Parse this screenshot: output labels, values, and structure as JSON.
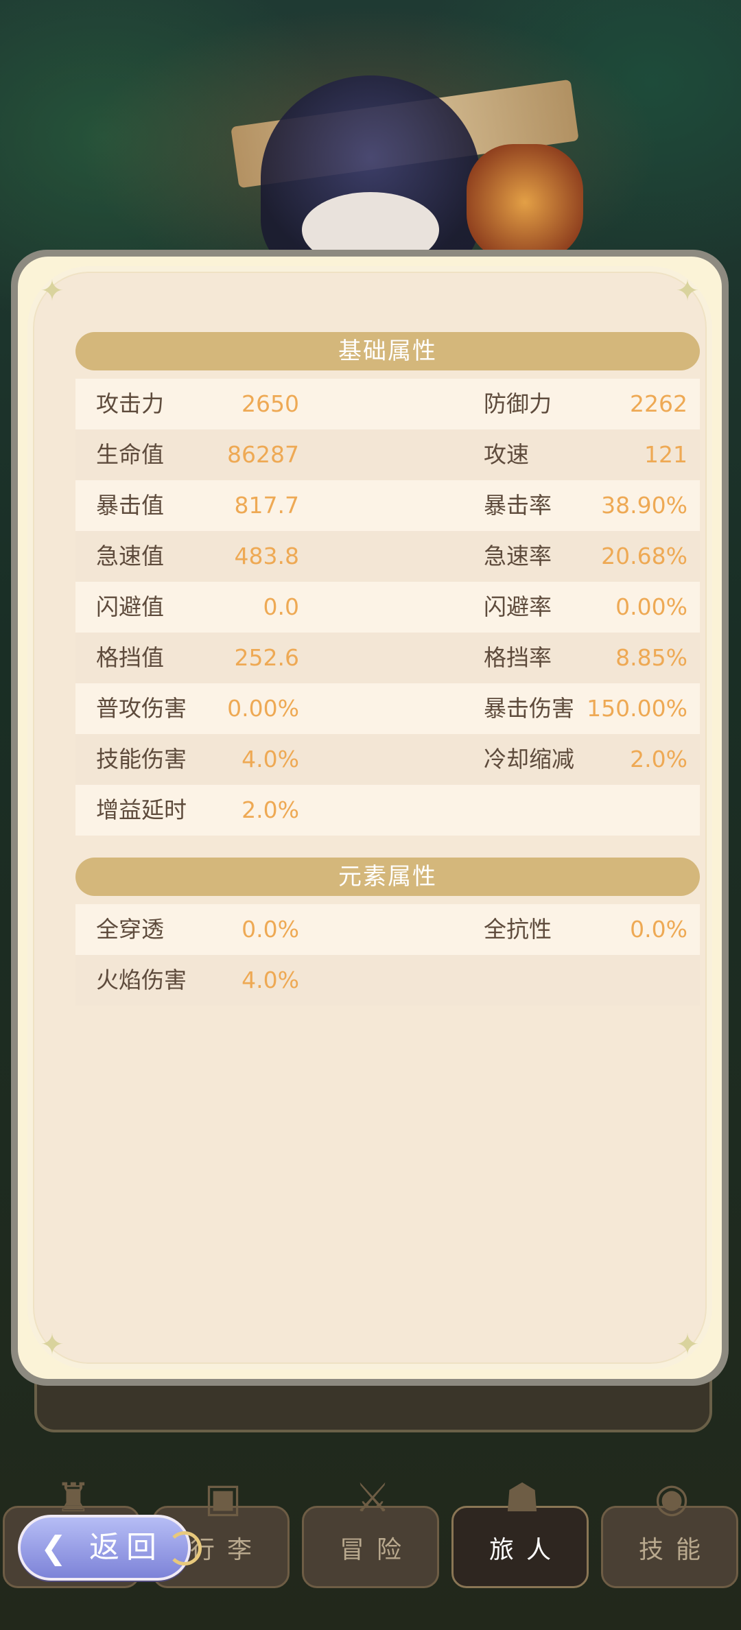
{
  "base_section": {
    "title": "基础属性",
    "rows": [
      {
        "left_label": "攻击力",
        "left_value": "2650",
        "right_label": "防御力",
        "right_value": "2262"
      },
      {
        "left_label": "生命值",
        "left_value": "86287",
        "right_label": "攻速",
        "right_value": "121"
      },
      {
        "left_label": "暴击值",
        "left_value": "817.7",
        "right_label": "暴击率",
        "right_value": "38.90%"
      },
      {
        "left_label": "急速值",
        "left_value": "483.8",
        "right_label": "急速率",
        "right_value": "20.68%"
      },
      {
        "left_label": "闪避值",
        "left_value": "0.0",
        "right_label": "闪避率",
        "right_value": "0.00%"
      },
      {
        "left_label": "格挡值",
        "left_value": "252.6",
        "right_label": "格挡率",
        "right_value": "8.85%"
      },
      {
        "left_label": "普攻伤害",
        "left_value": "0.00%",
        "right_label": "暴击伤害",
        "right_value": "150.00%"
      },
      {
        "left_label": "技能伤害",
        "left_value": "4.0%",
        "right_label": "冷却缩减",
        "right_value": "2.0%"
      },
      {
        "left_label": "增益延时",
        "left_value": "2.0%",
        "right_label": "",
        "right_value": ""
      }
    ]
  },
  "element_section": {
    "title": "元素属性",
    "rows": [
      {
        "left_label": "全穿透",
        "left_value": "0.0%",
        "right_label": "全抗性",
        "right_value": "0.0%"
      },
      {
        "left_label": "火焰伤害",
        "left_value": "4.0%",
        "right_label": "",
        "right_value": ""
      }
    ]
  },
  "nav": {
    "tabs": [
      {
        "label": "行李",
        "icon": "chest-icon"
      },
      {
        "label": "冒险",
        "icon": "crossed-swords-icon"
      },
      {
        "label": "旅人",
        "icon": "hooded-figure-icon"
      },
      {
        "label": "技能",
        "icon": "eye-emblem-icon"
      }
    ],
    "back_label": "返回"
  },
  "colors": {
    "header_bg": "#d4b77b",
    "value_text": "#eea954",
    "label_text": "#5e4b3c",
    "panel_bg": "#f5e8d6"
  }
}
